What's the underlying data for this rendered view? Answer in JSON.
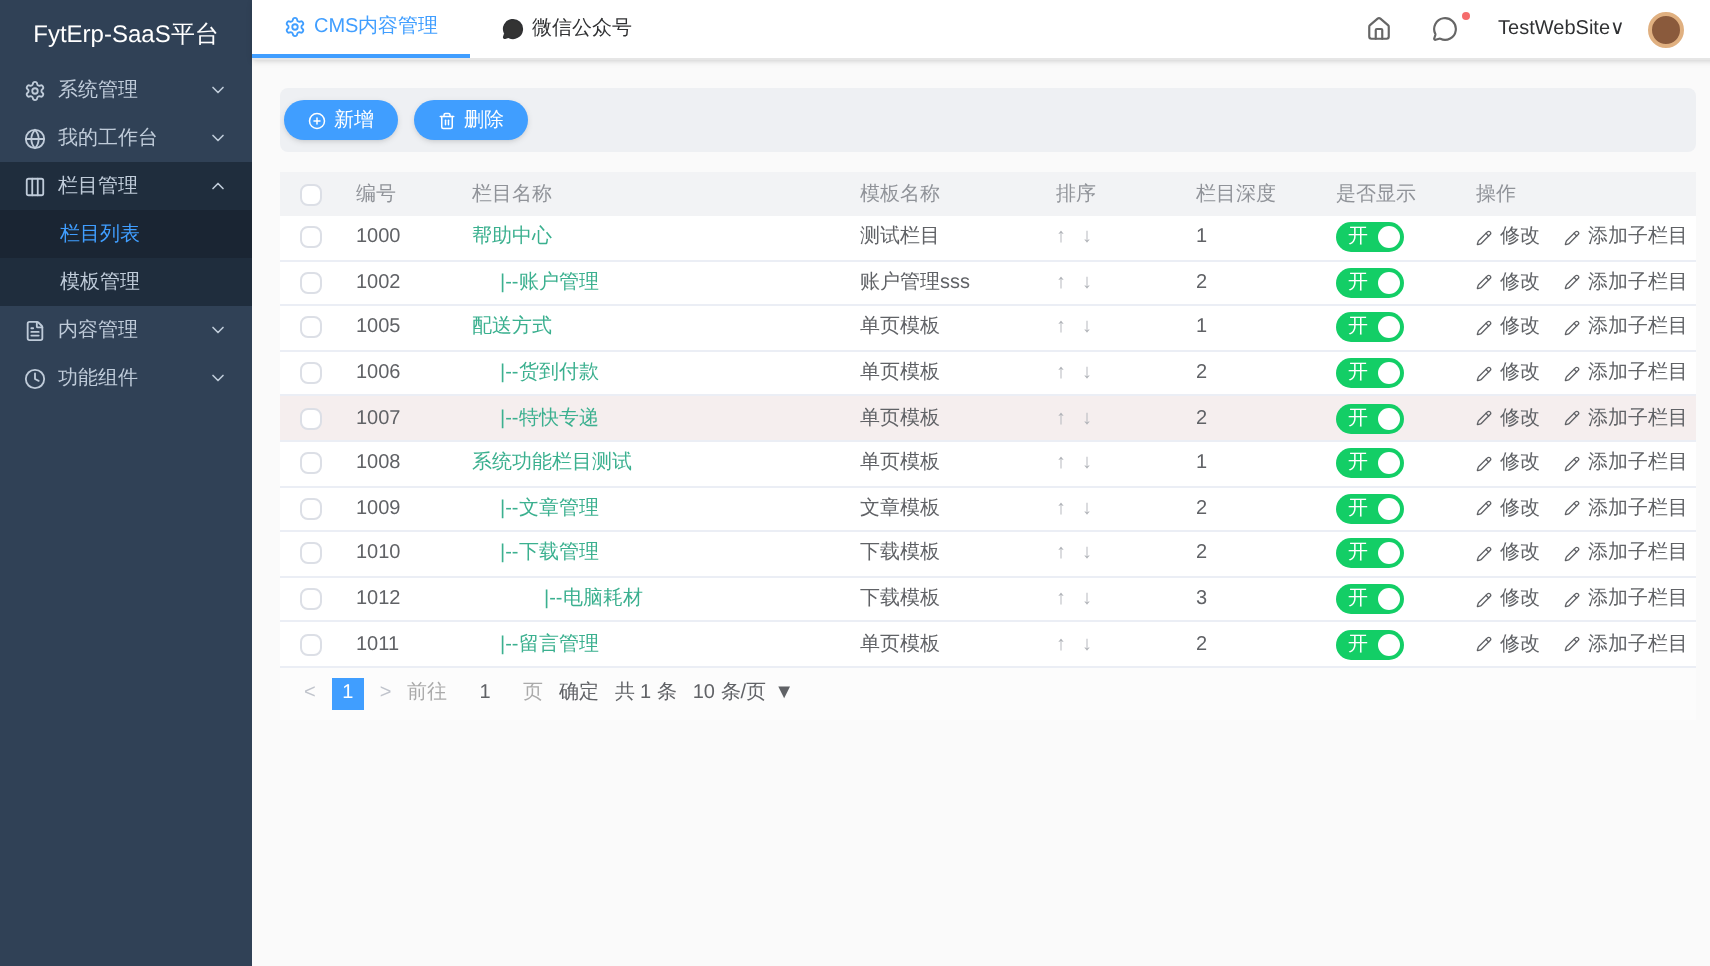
{
  "sidebar": {
    "title": "FytErp-SaaS平台",
    "items": [
      {
        "label": "系统管理",
        "expanded": false
      },
      {
        "label": "我的工作台",
        "expanded": false
      },
      {
        "label": "栏目管理",
        "expanded": true,
        "children": [
          {
            "label": "栏目列表",
            "selected": true
          },
          {
            "label": "模板管理",
            "selected": false
          }
        ]
      },
      {
        "label": "内容管理",
        "expanded": false
      },
      {
        "label": "功能组件",
        "expanded": false
      }
    ]
  },
  "tabs": [
    {
      "label": "CMS内容管理",
      "selected": true
    },
    {
      "label": "微信公众号",
      "selected": false
    }
  ],
  "header": {
    "user": "TestWebSite∨",
    "has_notice": true
  },
  "toolbar": [
    {
      "label": "新增"
    },
    {
      "label": "删除"
    }
  ],
  "table": {
    "all_checked": false,
    "columns": [
      "编号",
      "栏目名称",
      "模板名称",
      "排序",
      "栏目深度",
      "是否显示",
      "操作"
    ],
    "rows": [
      {
        "id": "1000",
        "name": "帮助中心",
        "template": "测试栏目",
        "sort": [
          "↑",
          "↓"
        ],
        "depth": "1",
        "toggle": "开",
        "on": true,
        "actions": [
          "修改",
          "添加子栏目"
        ],
        "highlighted": false,
        "checked": false,
        "children": [
          {
            "id": "1002",
            "name": "|--账户管理",
            "template": "账户管理sss",
            "sort": [
              "↑",
              "↓"
            ],
            "depth": "2",
            "toggle": "开",
            "on": true,
            "actions": [
              "修改",
              "添加子栏目"
            ],
            "highlighted": false,
            "checked": false
          }
        ]
      },
      {
        "id": "1005",
        "name": "配送方式",
        "template": "单页模板",
        "sort": [
          "↑",
          "↓"
        ],
        "depth": "1",
        "toggle": "开",
        "on": true,
        "actions": [
          "修改",
          "添加子栏目"
        ],
        "highlighted": false,
        "checked": false,
        "children": [
          {
            "id": "1006",
            "name": "|--货到付款",
            "template": "单页模板",
            "sort": [
              "↑",
              "↓"
            ],
            "depth": "2",
            "toggle": "开",
            "on": true,
            "actions": [
              "修改",
              "添加子栏目"
            ],
            "highlighted": false,
            "checked": false
          },
          {
            "id": "1007",
            "name": "|--特快专递",
            "template": "单页模板",
            "sort": [
              "↑",
              "↓"
            ],
            "depth": "2",
            "toggle": "开",
            "on": true,
            "actions": [
              "修改",
              "添加子栏目"
            ],
            "highlighted": true,
            "checked": false
          }
        ]
      },
      {
        "id": "1008",
        "name": "系统功能栏目测试",
        "template": "单页模板",
        "sort": [
          "↑",
          "↓"
        ],
        "depth": "1",
        "toggle": "开",
        "on": true,
        "actions": [
          "修改",
          "添加子栏目"
        ],
        "highlighted": false,
        "checked": false,
        "children": [
          {
            "id": "1009",
            "name": "|--文章管理",
            "template": "文章模板",
            "sort": [
              "↑",
              "↓"
            ],
            "depth": "2",
            "toggle": "开",
            "on": true,
            "actions": [
              "修改",
              "添加子栏目"
            ],
            "highlighted": false,
            "checked": false
          },
          {
            "id": "1010",
            "name": "|--下载管理",
            "template": "下载模板",
            "sort": [
              "↑",
              "↓"
            ],
            "depth": "2",
            "toggle": "开",
            "on": true,
            "actions": [
              "修改",
              "添加子栏目"
            ],
            "highlighted": false,
            "checked": false,
            "children": [
              {
                "id": "1012",
                "name": "|--电脑耗材",
                "template": "下载模板",
                "sort": [
                  "↑",
                  "↓"
                ],
                "depth": "3",
                "toggle": "开",
                "on": true,
                "actions": [
                  "修改",
                  "添加子栏目"
                ],
                "highlighted": false,
                "checked": false
              }
            ]
          },
          {
            "id": "1011",
            "name": "|--留言管理",
            "template": "单页模板",
            "sort": [
              "↑",
              "↓"
            ],
            "depth": "2",
            "toggle": "开",
            "on": true,
            "actions": [
              "修改",
              "添加子栏目"
            ],
            "highlighted": false,
            "checked": false
          }
        ]
      }
    ]
  },
  "pagination": {
    "prev": "<",
    "pages": [
      {
        "label": "1",
        "selected": true
      }
    ],
    "next": ">",
    "goto_label": "前往",
    "goto_value": "1",
    "page_unit": "页",
    "confirm": "确定",
    "total": "共 1 条",
    "page_size": "10 条/页",
    "page_size_caret": "▼"
  }
}
